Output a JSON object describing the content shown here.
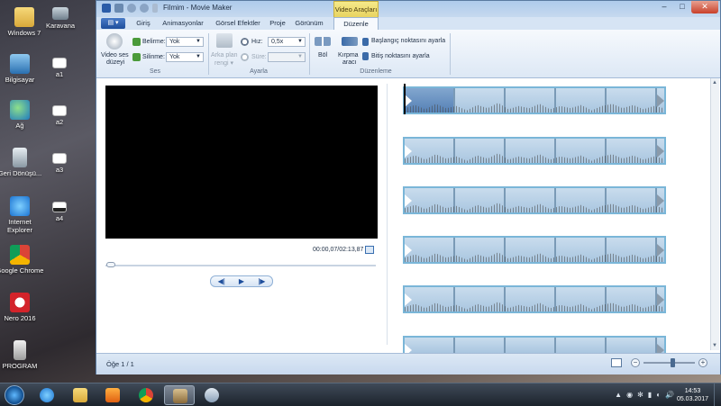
{
  "desktop": {
    "icons": [
      {
        "label": "Windows 7",
        "icon": "folder-icon"
      },
      {
        "label": "Karavana",
        "icon": "image-icon"
      },
      {
        "label": "Bilgisayar",
        "icon": "computer-icon"
      },
      {
        "label": "a1",
        "icon": "file-icon"
      },
      {
        "label": "Ağ",
        "icon": "network-icon"
      },
      {
        "label": "a2",
        "icon": "file-icon"
      },
      {
        "label": "Geri Dönüşü...",
        "icon": "recycle-bin-icon"
      },
      {
        "label": "a3",
        "icon": "file-icon"
      },
      {
        "label": "Internet Explorer",
        "icon": "ie-icon"
      },
      {
        "label": "a4",
        "icon": "file-icon"
      },
      {
        "label": "Google Chrome",
        "icon": "chrome-icon"
      },
      {
        "label": "Nero 2016",
        "icon": "nero-icon"
      },
      {
        "label": "PROGRAM",
        "icon": "program-icon"
      }
    ]
  },
  "window": {
    "title": "Filmim - Movie Maker",
    "context_tab_label": "Video Araçları",
    "buttons": {
      "minimize": "–",
      "maximize": "□",
      "close": "✕"
    }
  },
  "tabs": {
    "file": "▤ ▾",
    "items": [
      "Giriş",
      "Animasyonlar",
      "Görsel Efektler",
      "Proje",
      "Görünüm",
      "Düzenle"
    ],
    "active": "Düzenle"
  },
  "ribbon": {
    "ses": {
      "volume_label_1": "Video ses",
      "volume_label_2": "düzeyi",
      "fade_in_label": "Belirme:",
      "fade_in_value": "Yok",
      "fade_out_label": "Silinme:",
      "fade_out_value": "Yok",
      "group_label": "Ses"
    },
    "ayarla": {
      "bg_color_label_1": "Arka plan",
      "bg_color_label_2": "rengi ▾",
      "speed_label": "Hız:",
      "speed_value": "0,5x",
      "duration_label": "Süre:",
      "duration_value": "",
      "group_label": "Ayarla"
    },
    "duzenleme": {
      "split_label": "Böl",
      "trim_label_1": "Kırpma",
      "trim_label_2": "aracı",
      "set_start": "Başlangıç noktasını ayarla",
      "set_end": "Bitiş noktasını ayarla",
      "group_label": "Düzenleme"
    }
  },
  "preview": {
    "timecode": "00:00,07/02:13,87",
    "controls": {
      "prev": "◀|",
      "play": "▶",
      "next": "|▶"
    }
  },
  "status": {
    "item_count": "Öğe 1 / 1"
  },
  "taskbar": {
    "apps": [
      "ie-icon",
      "explorer-icon",
      "media-player-icon",
      "chrome-icon",
      "movie-maker-icon",
      "paint-icon"
    ],
    "tray": [
      "▲",
      "◉",
      "✻",
      "▮",
      "◐",
      "🔊"
    ],
    "time": "14:53",
    "date": "05.03.2017"
  },
  "colors": {
    "ribbon_accent": "#1e4e9c",
    "context_tab": "#e8d360",
    "timeline_border": "#7ab6d8"
  }
}
